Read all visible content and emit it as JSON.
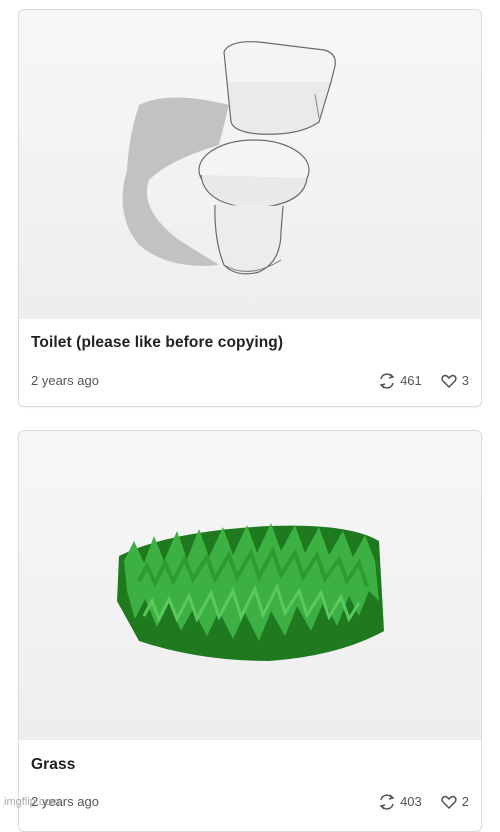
{
  "cards": [
    {
      "title": "Toilet (please like before copying)",
      "age": "2 years ago",
      "remix_count": "461",
      "like_count": "3",
      "thumbnail": "toilet-model"
    },
    {
      "title": "Grass",
      "age": "2 years ago",
      "remix_count": "403",
      "like_count": "2",
      "thumbnail": "grass-model"
    }
  ],
  "icons": {
    "remix": "remix-icon",
    "like": "heart-icon"
  },
  "colors": {
    "grass": "#3cb043",
    "grass_dark": "#1f7a1f",
    "toilet": "#f2f2f2"
  },
  "watermark": "imgflip.com"
}
